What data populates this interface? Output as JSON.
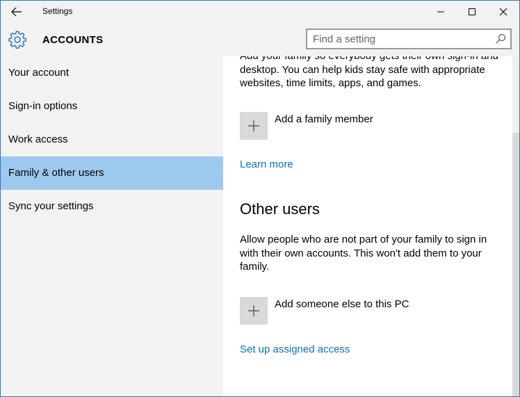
{
  "titlebar": {
    "title": "Settings",
    "back_icon": "back-arrow-icon",
    "minimize_icon": "minimize-icon",
    "maximize_icon": "maximize-icon",
    "close_icon": "close-icon"
  },
  "header": {
    "icon": "gear-icon",
    "title": "ACCOUNTS",
    "search_placeholder": "Find a setting",
    "search_value": "",
    "search_icon": "search-icon"
  },
  "sidebar": {
    "items": [
      {
        "label": "Your account",
        "selected": false
      },
      {
        "label": "Sign-in options",
        "selected": false
      },
      {
        "label": "Work access",
        "selected": false
      },
      {
        "label": "Family & other users",
        "selected": true
      },
      {
        "label": "Sync your settings",
        "selected": false
      }
    ]
  },
  "content": {
    "family_text_line1": "Add your family so everybody gets their own sign-in and",
    "family_text_line2": "desktop. You can help kids stay safe with appropriate",
    "family_text_line3": "websites, time limits, apps, and games.",
    "add_family_label": "Add a family member",
    "learn_more": "Learn more",
    "other_users_title": "Other users",
    "other_text_line1": "Allow people who are not part of your family to sign in",
    "other_text_line2": "with their own accounts. This won't add them to your",
    "other_text_line3": "family.",
    "add_other_label": "Add someone else to this PC",
    "assigned_access": "Set up assigned access"
  },
  "colors": {
    "accent": "#0b6fc7",
    "selected_bg": "#9ec9ee",
    "sidebar_bg": "#f2f2f2",
    "add_box_bg": "#d9d9d9"
  }
}
